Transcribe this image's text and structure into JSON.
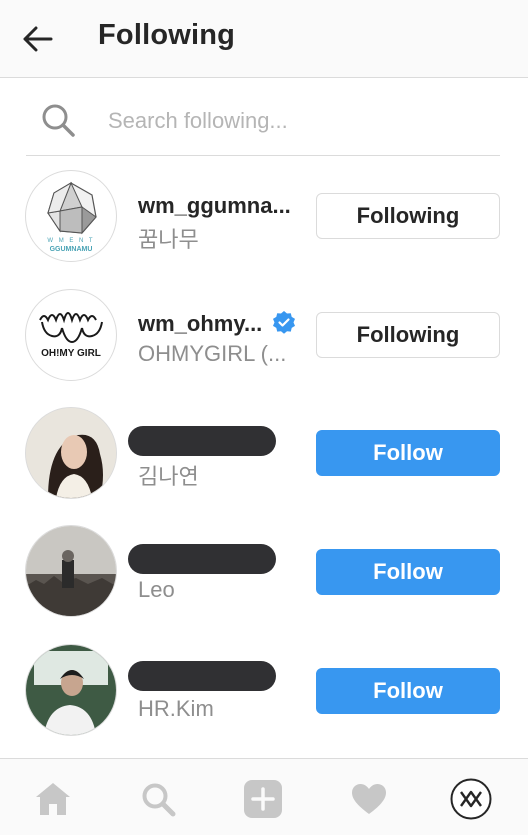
{
  "header": {
    "title": "Following",
    "back_icon": "arrow-left-icon"
  },
  "search": {
    "placeholder": "Search following...",
    "value": "",
    "icon": "search-icon"
  },
  "accounts": [
    {
      "username": "wm_ggumna...",
      "full_name": "꿈나무",
      "verified": false,
      "button_label": "Following",
      "button_state": "following",
      "logo_text": "GGUMNAMU",
      "logo_subtext": "W M E N T"
    },
    {
      "username": "wm_ohmy...",
      "full_name": "OHMYGIRL (...",
      "verified": true,
      "button_label": "Following",
      "button_state": "following",
      "logo_text": "OH!MY GIRL"
    },
    {
      "username": "",
      "full_name": "김나연",
      "verified": false,
      "username_redacted": true,
      "button_label": "Follow",
      "button_state": "follow"
    },
    {
      "username": "",
      "full_name": "Leo",
      "verified": false,
      "username_redacted": true,
      "button_label": "Follow",
      "button_state": "follow"
    },
    {
      "username": "",
      "full_name": "HR.Kim",
      "verified": false,
      "username_redacted": true,
      "button_label": "Follow",
      "button_state": "follow"
    }
  ],
  "bottom_nav": {
    "items": [
      "home-icon",
      "search-icon",
      "add-post-icon",
      "heart-icon",
      "profile-avatar"
    ]
  },
  "colors": {
    "follow_blue": "#3897f0",
    "verified_blue": "#3897f0",
    "muted_text": "#8e8e8e",
    "border": "#dbdbdb"
  }
}
